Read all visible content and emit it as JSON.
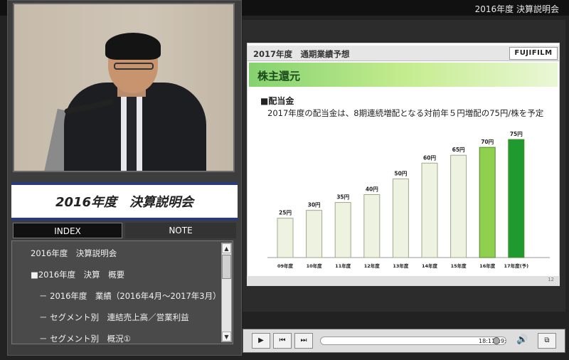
{
  "window": {
    "title": "2016年度 決算説明会"
  },
  "panel": {
    "title": "2016年度　決算説明会"
  },
  "tabs": {
    "index": "INDEX",
    "note": "NOTE"
  },
  "index_items": [
    "2016年度　決算説明会",
    "■2016年度　決算　概要",
    "－ 2016年度　業績（2016年4月～2017年3月）",
    "－ セグメント別　連結売上高／営業利益",
    "－ セグメント別　概況①"
  ],
  "slide": {
    "header": "2017年度　通期業績予想",
    "logo": "FUJIFILM",
    "banner": "株主還元",
    "section": "■配当金",
    "description": "2017年度の配当金は、8期連続増配となる対前年５円増配の75円/株を予定",
    "page_number": "12"
  },
  "player": {
    "time": "18:11/19:",
    "progress": 0.96,
    "icons": [
      "play-icon",
      "skip-back-icon",
      "skip-forward-icon",
      "volume-icon",
      "window-mode-icon"
    ]
  },
  "colors": {
    "banner": "#86d270",
    "bar_default": "#eef2e0",
    "bar_16": "#8fd14f",
    "bar_17": "#1f9a2f",
    "header_navy": "#2a3a7a"
  },
  "chart_data": {
    "type": "bar",
    "categories": [
      "09年度",
      "10年度",
      "11年度",
      "12年度",
      "13年度",
      "14年度",
      "15年度",
      "16年度",
      "17年度(予)"
    ],
    "values": [
      25,
      30,
      35,
      40,
      50,
      60,
      65,
      70,
      75
    ],
    "value_labels": [
      "25円",
      "30円",
      "35円",
      "40円",
      "50円",
      "60円",
      "65円",
      "70円",
      "75円"
    ],
    "ylim": [
      0,
      80
    ],
    "grid": false,
    "highlight": {
      "16年度": "#8fd14f",
      "17年度(予)": "#1f9a2f"
    }
  }
}
